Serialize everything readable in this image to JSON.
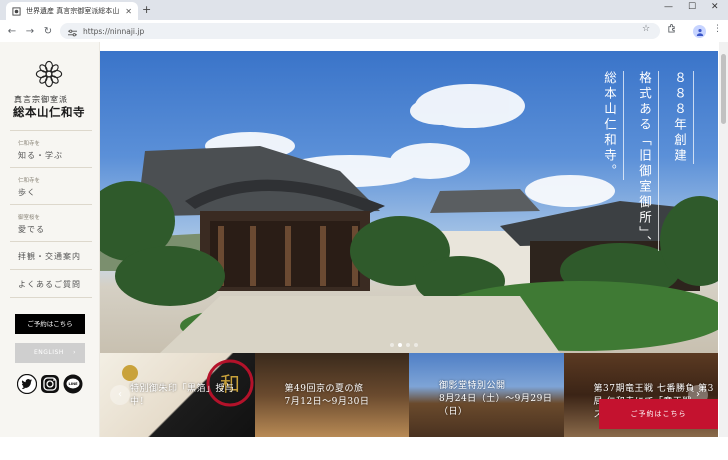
{
  "browser": {
    "tab_title": "世界遺産 真言宗御室派総本山…",
    "url": "https://ninnaji.jp",
    "new_tab": "+",
    "minimize": "—",
    "maximize": "☐",
    "close": "✕",
    "tab_close": "✕"
  },
  "sidebar": {
    "sect": "真言宗御室派",
    "temple": "総本山仁和寺",
    "menu": [
      {
        "sub": "仁和寺を",
        "label": "知る・学ぶ"
      },
      {
        "sub": "仁和寺を",
        "label": "歩く"
      },
      {
        "sub": "御室桜を",
        "label": "愛でる"
      },
      {
        "label": "拝観・交通案内"
      },
      {
        "label": "よくあるご質問"
      }
    ],
    "reserve": "ご予約はこちら",
    "english": "ENGLISH",
    "english_arrow": "›",
    "social": {
      "x": "X",
      "line": "LINE"
    }
  },
  "hero": {
    "tagline_lines": [
      "８８８年創建",
      "格式ある「旧御室御所」、",
      "総本山仁和寺。"
    ]
  },
  "cards": [
    {
      "line1": "特別御朱印「黒箔」授与",
      "line2": "中！",
      "stamp": "和"
    },
    {
      "line1": "第49回京の夏の旅",
      "line2": "7月12日～9月30日"
    },
    {
      "line1": "御影堂特別公開",
      "line2": "8月24日（土）～9月29日",
      "line3": "（日）"
    },
    {
      "line1": "第37期竜王戦 七番勝負 第3",
      "line2": "局 仁和寺にて「竜王戦",
      "line3": "ス"
    }
  ],
  "carousel": {
    "prev": "‹",
    "next": "›"
  },
  "reserve_fixed": "ご予約はこちら",
  "colors": {
    "accent_red": "#c4122f",
    "sidebar_bg": "#f7f6f2"
  }
}
